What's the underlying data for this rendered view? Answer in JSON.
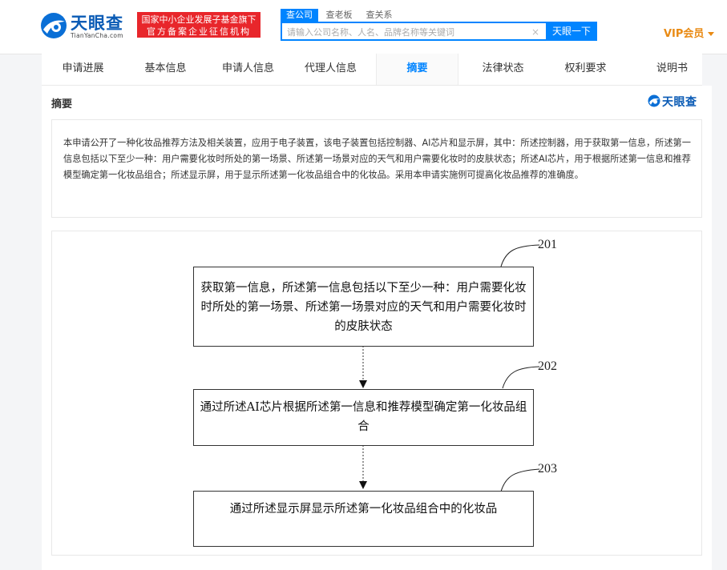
{
  "header": {
    "logo": {
      "name": "天眼查",
      "sub": "TianYanCha.com"
    },
    "badge": {
      "line1": "国家中小企业发展子基金旗下",
      "line2": "官方备案企业征信机构"
    },
    "search_tabs": [
      "查公司",
      "查老板",
      "查关系"
    ],
    "search": {
      "placeholder": "请输入公司名称、人名、品牌名称等关键词",
      "value": ""
    },
    "search_button": "天眼一下",
    "vip_label": "VIP会员",
    "colors": {
      "brand": "#0a5bb5",
      "accent": "#0084ff",
      "badge": "#e8262b",
      "vip": "#e98a13"
    }
  },
  "tabs": {
    "items": [
      "申请进展",
      "基本信息",
      "申请人信息",
      "代理人信息",
      "摘要",
      "法律状态",
      "权利要求",
      "说明书"
    ],
    "active": "摘要"
  },
  "section": {
    "title": "摘要",
    "brand": "天眼查",
    "abstract": "本申请公开了一种化妆品推荐方法及相关装置，应用于电子装置，该电子装置包括控制器、AI芯片和显示屏，其中：所述控制器，用于获取第一信息，所述第一信息包括以下至少一种：用户需要化妆时所处的第一场景、所述第一场景对应的天气和用户需要化妆时的皮肤状态；所述AI芯片，用于根据所述第一信息和推荐模型确定第一化妆品组合；所述显示屏，用于显示所述第一化妆品组合中的化妆品。采用本申请实施例可提高化妆品推荐的准确度。"
  },
  "figure": {
    "steps": [
      {
        "ref": "201",
        "text": "获取第一信息，所述第一信息包括以下至少一种：用户需要化妆时所处的第一场景、所述第一场景对应的天气和用户需要化妆时的皮肤状态"
      },
      {
        "ref": "202",
        "text": "通过所述AI芯片根据所述第一信息和推荐模型确定第一化妆品组合"
      },
      {
        "ref": "203",
        "text": "通过所述显示屏显示所述第一化妆品组合中的化妆品"
      }
    ]
  }
}
